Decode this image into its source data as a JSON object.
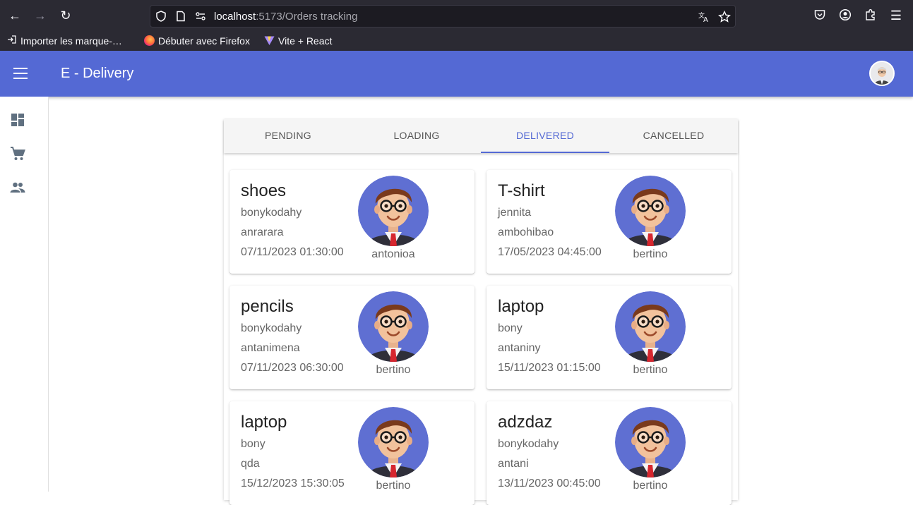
{
  "browser": {
    "url_host": "localhost",
    "url_rest": ":5173/Orders tracking",
    "bookmarks": [
      {
        "label": "Importer les marque-…"
      },
      {
        "label": "Débuter avec Firefox"
      },
      {
        "label": "Vite + React"
      }
    ]
  },
  "app": {
    "title": "E - Delivery",
    "accent_color": "#5469d4"
  },
  "sidebar": {
    "items": [
      {
        "icon": "dashboard-icon"
      },
      {
        "icon": "cart-icon"
      },
      {
        "icon": "people-icon"
      }
    ]
  },
  "tabs": [
    {
      "label": "PENDING",
      "active": false
    },
    {
      "label": "LOADING",
      "active": false
    },
    {
      "label": "DELIVERED",
      "active": true
    },
    {
      "label": "CANCELLED",
      "active": false
    }
  ],
  "orders": [
    {
      "product": "shoes",
      "customer": "bonykodahy",
      "address": "anrarara",
      "datetime": "07/11/2023 01:30:00",
      "driver": "antonioa"
    },
    {
      "product": "T-shirt",
      "customer": "jennita",
      "address": "ambohibao",
      "datetime": "17/05/2023 04:45:00",
      "driver": "bertino"
    },
    {
      "product": "pencils",
      "customer": "bonykodahy",
      "address": "antanimena",
      "datetime": "07/11/2023 06:30:00",
      "driver": "bertino"
    },
    {
      "product": "laptop",
      "customer": "bony",
      "address": "antaniny",
      "datetime": "15/11/2023 01:15:00",
      "driver": "bertino"
    },
    {
      "product": "laptop",
      "customer": "bony",
      "address": "qda",
      "datetime": "15/12/2023 15:30:05",
      "driver": "bertino"
    },
    {
      "product": "adzdaz",
      "customer": "bonykodahy",
      "address": "antani",
      "datetime": "13/11/2023 00:45:00",
      "driver": "bertino"
    }
  ]
}
